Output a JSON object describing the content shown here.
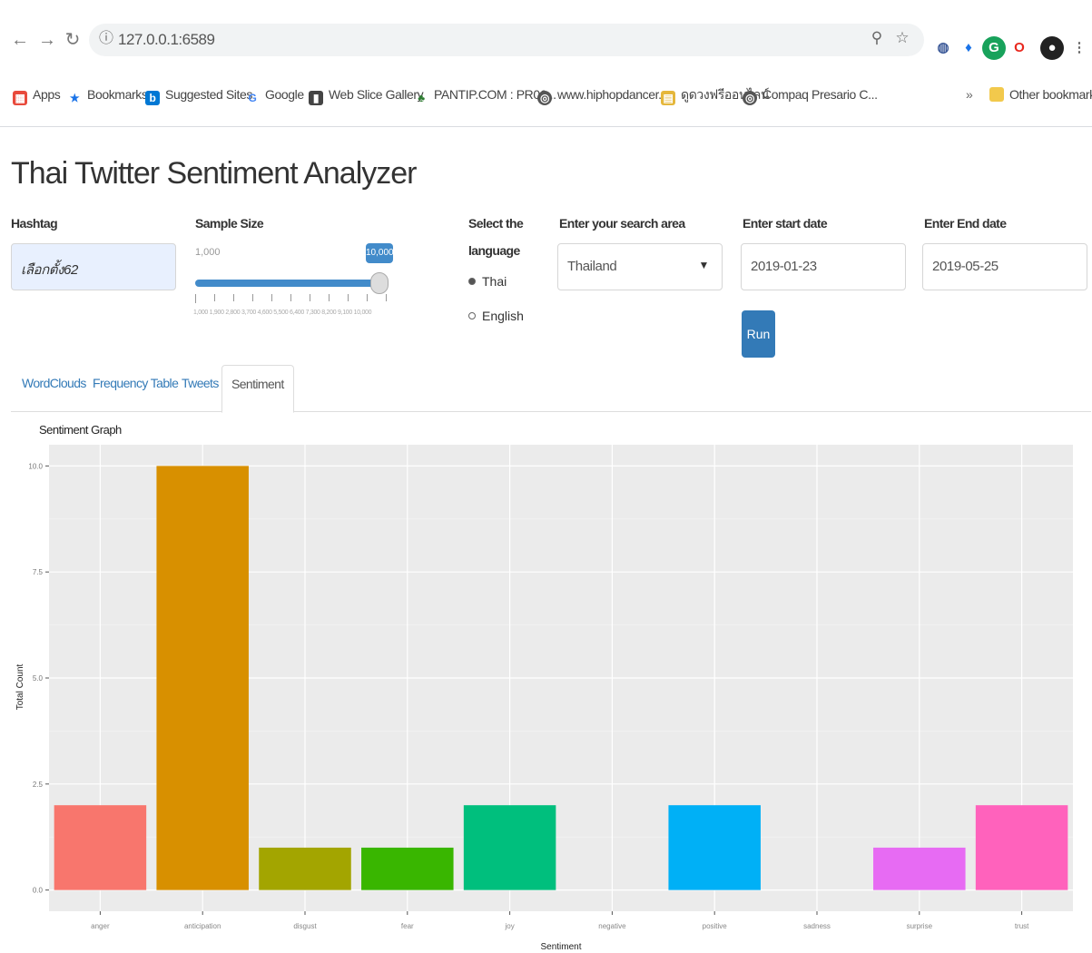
{
  "browser": {
    "url": "127.0.0.1:6589",
    "bookmarks": [
      {
        "label": "Apps",
        "icon": "apps-grid-icon",
        "color": "#e84a3c"
      },
      {
        "label": "Bookmarks",
        "icon": "star-icon",
        "color": "#1a73e8"
      },
      {
        "label": "Suggested Sites",
        "icon": "bing-icon",
        "color": "#0078d4"
      },
      {
        "label": "Google",
        "icon": "google-icon",
        "color": "#4285f4"
      },
      {
        "label": "Web Slice Gallery",
        "icon": "web-slice-icon",
        "color": "#444444"
      },
      {
        "label": "PANTIP.COM : PR06...",
        "icon": "pantip-icon",
        "color": "#2e7d32"
      },
      {
        "label": "www.hiphopdancer....",
        "icon": "globe-icon",
        "color": "#555555"
      },
      {
        "label": "ดูดวงฟรีออนไลน์",
        "icon": "folder-icon",
        "color": "#e5b73b"
      },
      {
        "label": "Compaq Presario C...",
        "icon": "globe-icon",
        "color": "#555555"
      }
    ],
    "overflow": "»",
    "other_bookmarks": "Other bookmarks"
  },
  "app": {
    "title": "Thai Twitter Sentiment Analyzer",
    "hashtag": {
      "label": "Hashtag",
      "value": "เลือกตั้ง62"
    },
    "sample_size": {
      "label": "Sample Size",
      "min_label": "1,000",
      "value_label": "10,000",
      "value_fraction": 1.0,
      "tick_labels": "1,000 1,900 2,800 3,700 4,600 5,500 6,400 7,300 8,200 9,100 10,000"
    },
    "language": {
      "label_line1": "Select the",
      "label_line2": "language",
      "options": [
        "Thai",
        "English"
      ],
      "selected": "Thai"
    },
    "area": {
      "label": "Enter your search area",
      "value": "Thailand"
    },
    "start_date": {
      "label": "Enter start date",
      "value": "2019-01-23"
    },
    "end_date": {
      "label": "Enter End date",
      "value": "2019-05-25"
    },
    "run_label": "Run",
    "tabs": [
      "WordClouds",
      "Frequency Table",
      "Tweets",
      "Sentiment"
    ],
    "active_tab": "Sentiment"
  },
  "chart_data": {
    "type": "bar",
    "title": "Sentiment Graph",
    "xlabel": "Sentiment",
    "ylabel": "Total Count",
    "categories": [
      "anger",
      "anticipation",
      "disgust",
      "fear",
      "joy",
      "negative",
      "positive",
      "sadness",
      "surprise",
      "trust"
    ],
    "values": [
      2.0,
      10.0,
      1.0,
      1.0,
      2.0,
      0,
      2.0,
      0,
      1.0,
      2.0
    ],
    "colors": [
      "#f8766d",
      "#d89000",
      "#a3a500",
      "#39b600",
      "#00bf7d",
      "#00bfc4",
      "#00b0f6",
      "#9590ff",
      "#e76bf3",
      "#ff62bc"
    ],
    "y_ticks": [
      "0.0",
      "2.5",
      "5.0",
      "7.5",
      "10.0"
    ],
    "ylim": [
      -0.5,
      10.5
    ],
    "grid": true,
    "background": "#ebebeb"
  }
}
